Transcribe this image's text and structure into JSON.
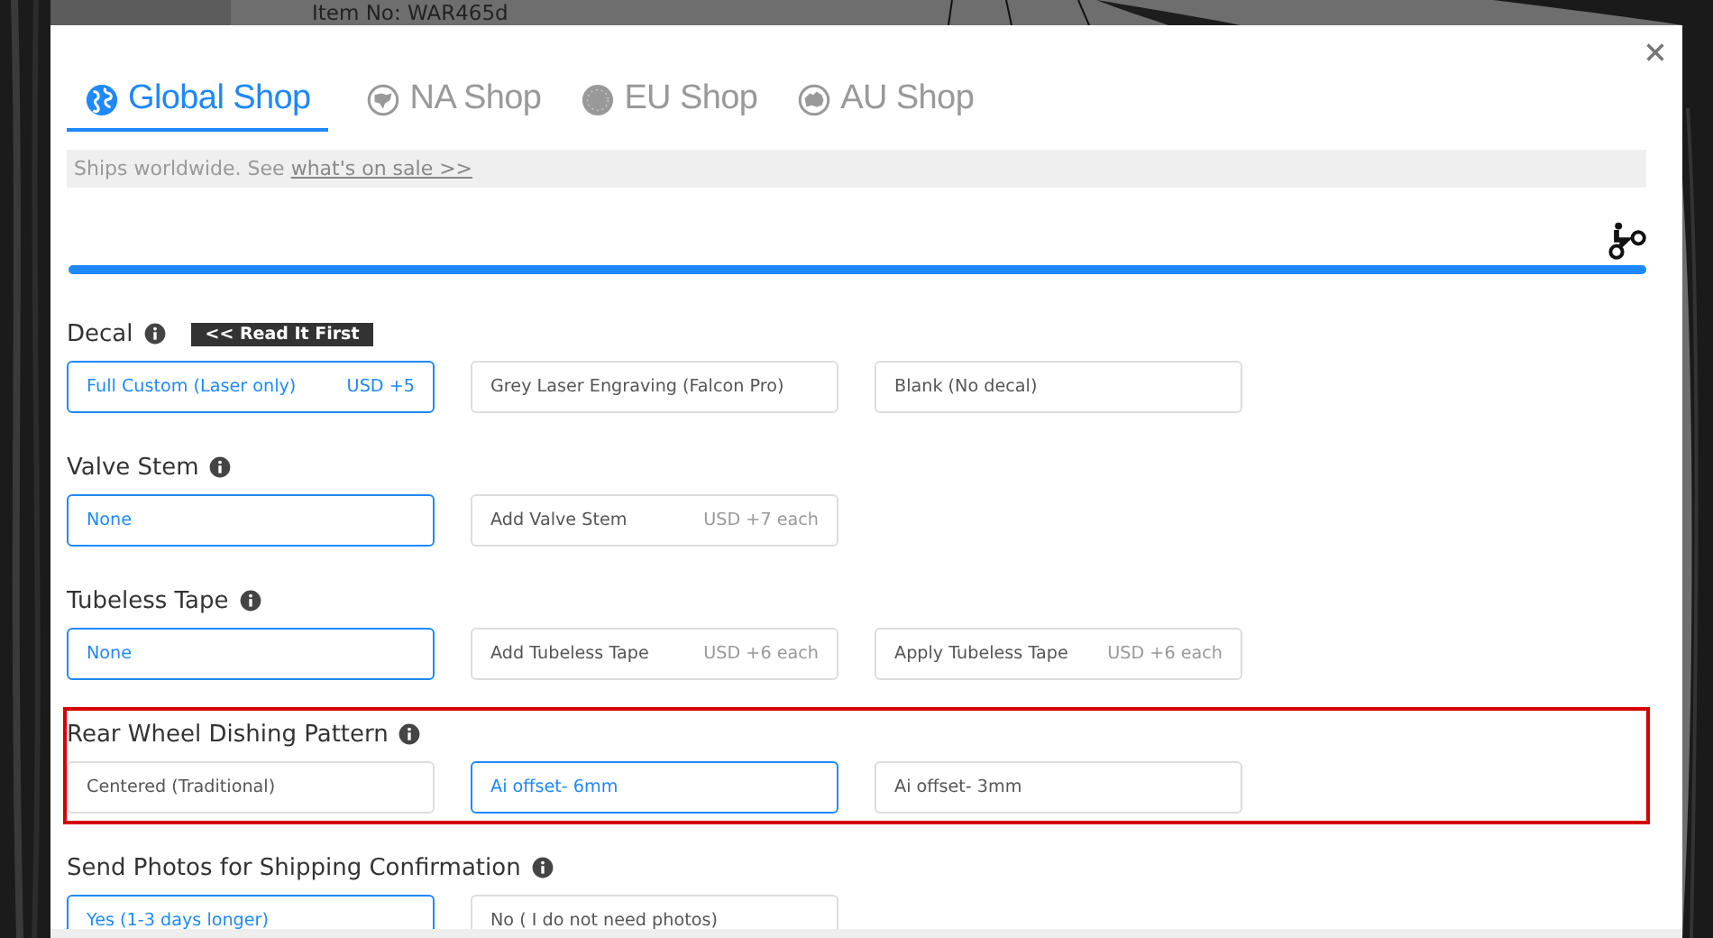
{
  "background": {
    "item_number": "Item No: WAR465d"
  },
  "tabs": [
    {
      "label": "Global Shop",
      "selected": true
    },
    {
      "label": "NA Shop",
      "selected": false
    },
    {
      "label": "EU Shop",
      "selected": false
    },
    {
      "label": "AU Shop",
      "selected": false
    }
  ],
  "notice": {
    "text": "Ships worldwide. See ",
    "link": "what's on sale >>"
  },
  "progress": {
    "level": 1
  },
  "groups": [
    {
      "title": "Decal",
      "badge": "<< Read It First",
      "highlighted": false,
      "options": [
        {
          "label": "Full Custom (Laser only)",
          "price": "USD +5",
          "selected": true
        },
        {
          "label": "Grey Laser Engraving (Falcon Pro)",
          "selected": false
        },
        {
          "label": "Blank (No decal)",
          "selected": false
        }
      ]
    },
    {
      "title": "Valve Stem",
      "highlighted": false,
      "options": [
        {
          "label": "None",
          "selected": true
        },
        {
          "label": "Add Valve Stem",
          "price": "USD +7 each",
          "selected": false
        }
      ]
    },
    {
      "title": "Tubeless Tape",
      "highlighted": false,
      "options": [
        {
          "label": "None",
          "selected": true
        },
        {
          "label": "Add Tubeless Tape",
          "price": "USD +6 each",
          "selected": false
        },
        {
          "label": "Apply Tubeless Tape",
          "price": "USD +6 each",
          "selected": false
        }
      ]
    },
    {
      "title": "Rear Wheel Dishing Pattern",
      "highlighted": true,
      "options": [
        {
          "label": "Centered (Traditional)",
          "selected": false
        },
        {
          "label": "Ai offset- 6mm",
          "selected": true
        },
        {
          "label": "Ai offset- 3mm",
          "selected": false
        }
      ]
    },
    {
      "title": "Send Photos for Shipping Confirmation",
      "highlighted": false,
      "options": [
        {
          "label": "Yes (1-3 days longer)",
          "selected": true
        },
        {
          "label": "No ( I do not need photos)",
          "selected": false
        }
      ]
    }
  ]
}
